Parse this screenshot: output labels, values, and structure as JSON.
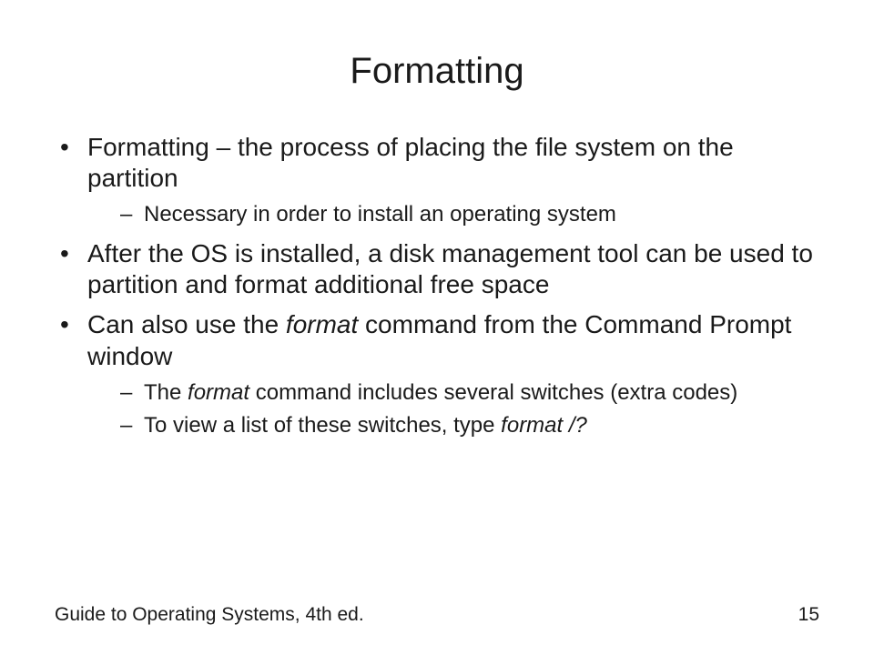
{
  "title": "Formatting",
  "bullets": {
    "b1": "Formatting – the process of placing the file system on the partition",
    "b1s1": "Necessary in order to install an operating system",
    "b2": "After the OS is installed, a disk management tool can be used to partition and format additional free space",
    "b3a": "Can also use the ",
    "b3b": "format",
    "b3c": " command from the Command Prompt window",
    "b3s1a": "The ",
    "b3s1b": "format",
    "b3s1c": " command includes several switches (extra codes)",
    "b3s2a": "To view a list of these switches, type ",
    "b3s2b": "format /?"
  },
  "footer": {
    "source": "Guide to Operating Systems, 4th ed.",
    "page": "15"
  }
}
